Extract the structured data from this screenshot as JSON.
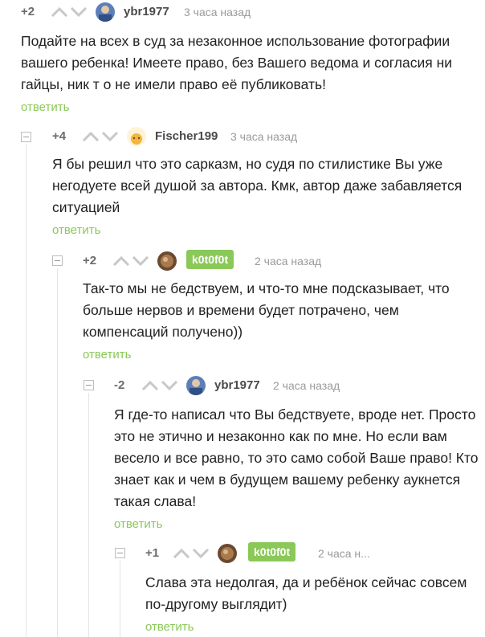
{
  "comments": [
    {
      "rating": "+2",
      "author": "ybr1977",
      "time": "3 часа назад",
      "text": "Подайте на всех в суд за незаконное использование фотографии вашего ребенка! Имеете право, без Вашего ведома и согласия ни гайцы, ник т о не имели право её публиковать!",
      "reply": "ответить",
      "avatar": "avatar-blue"
    },
    {
      "rating": "+4",
      "author": "Fischer199",
      "time": "3 часа назад",
      "text": "Я бы решил что это сарказм, но судя по стилистике Вы уже негодуете всей душой за автора. Кмк, автор даже забавляется ситуацией",
      "reply": "ответить",
      "avatar": "avatar-yellow"
    },
    {
      "rating": "+2",
      "author": "k0t0f0t",
      "time": "2 часа назад",
      "text": "Так-то мы не бедствуем, и что-то мне подсказывает, что больше нервов и времени будет потрачено, чем компенсаций получено))",
      "reply": "ответить",
      "avatar": "avatar-brown"
    },
    {
      "rating": "-2",
      "author": "ybr1977",
      "time": "2 часа назад",
      "text": "Я где-то написал что Вы бедствуете, вроде нет. Просто это не этично и незаконно как по мне. Но если вам весело и все равно, то это само собой Ваше право! Кто знает как и чем в будущем вашему ребенку аукнется такая слава!",
      "reply": "ответить",
      "avatar": "avatar-blue"
    },
    {
      "rating": "+1",
      "author": "k0t0f0t",
      "time": "2 часа н...",
      "text": "Слава эта недолгая, да и ребёнок сейчас совсем по-другому выглядит)",
      "reply": "ответить",
      "avatar": "avatar-brown"
    }
  ],
  "colors": {
    "accent": "#8ac858",
    "author_badge": "#8ac858",
    "text": "#222222",
    "meta": "#9a9a9a"
  }
}
